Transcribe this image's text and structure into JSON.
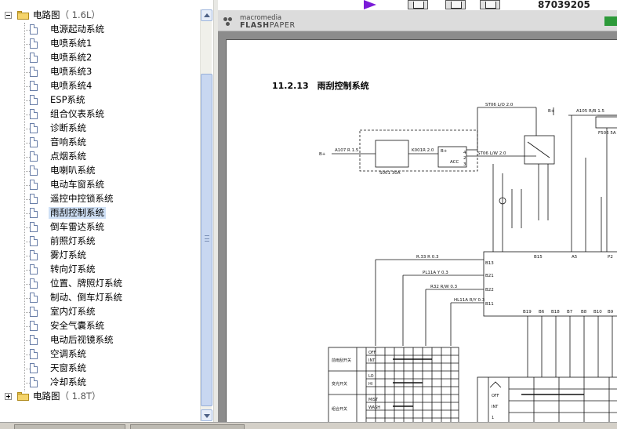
{
  "tree": {
    "root_open": {
      "label": "电路图",
      "version": "（ 1.6L）"
    },
    "items": [
      "电源起动系统",
      "电喷系统1",
      "电喷系统2",
      "电喷系统3",
      "电喷系统4",
      "ESP系统",
      "组合仪表系统",
      "诊断系统",
      "音响系统",
      "点烟系统",
      "电喇叭系统",
      "电动车窗系统",
      "遥控中控锁系统",
      "雨刮控制系统",
      "倒车雷达系统",
      "前照灯系统",
      "雾灯系统",
      "转向灯系统",
      "位置、牌照灯系统",
      "制动、倒车灯系统",
      "室内灯系统",
      "安全气囊系统",
      "电动后视镜系统",
      "空调系统",
      "天窗系统",
      "冷却系统"
    ],
    "selected_index": 13,
    "root_closed": {
      "label": "电路图",
      "version": "（ 1.8T）"
    }
  },
  "viewer": {
    "top_number": "87039205",
    "brand": "macromedia",
    "product_a": "FLASH",
    "product_b": "PAPER"
  },
  "page": {
    "section_title": "11.2.13　雨刮控制系统",
    "labels": {
      "b_plus_left": "B+",
      "a107": "A107 R 1.5",
      "s001": "S001 30A",
      "k001": "K001R 2.0",
      "b_plus_sw": "B+",
      "kl": "ACC",
      "sw_pin4": "4",
      "sw_pin2": "2",
      "sw_pin3": "3",
      "st06a": "ST06 L/O 2.0",
      "st06b": "ST06 L/W 2.0",
      "b_plus_right": "B+",
      "a105": "A105 R/B 1.5",
      "f506": "F506 5A",
      "b13": "B13",
      "b15": "B15",
      "a5": "A5",
      "b21": "B21",
      "b22": "B22",
      "b11": "B11",
      "r33": "R.33 R 0.3",
      "pl11": "PL11A Y 0.3",
      "r32": "R32 R/W 0.3",
      "hl11": "HL11A R/Y 0.3",
      "b19": "B19",
      "b6": "B6",
      "b18": "B18",
      "b7": "B7",
      "b8": "B8",
      "b10": "B10",
      "b9": "B9",
      "p2": "P2"
    },
    "switch_table": {
      "rows": [
        "OFF",
        "INT",
        "LO",
        "HI",
        "MIST",
        "WASH"
      ],
      "row_heads": [
        "前雨刮开关",
        "变光开关",
        "组合开关"
      ],
      "small_rows": [
        "OFF",
        "INT",
        "1"
      ]
    }
  }
}
